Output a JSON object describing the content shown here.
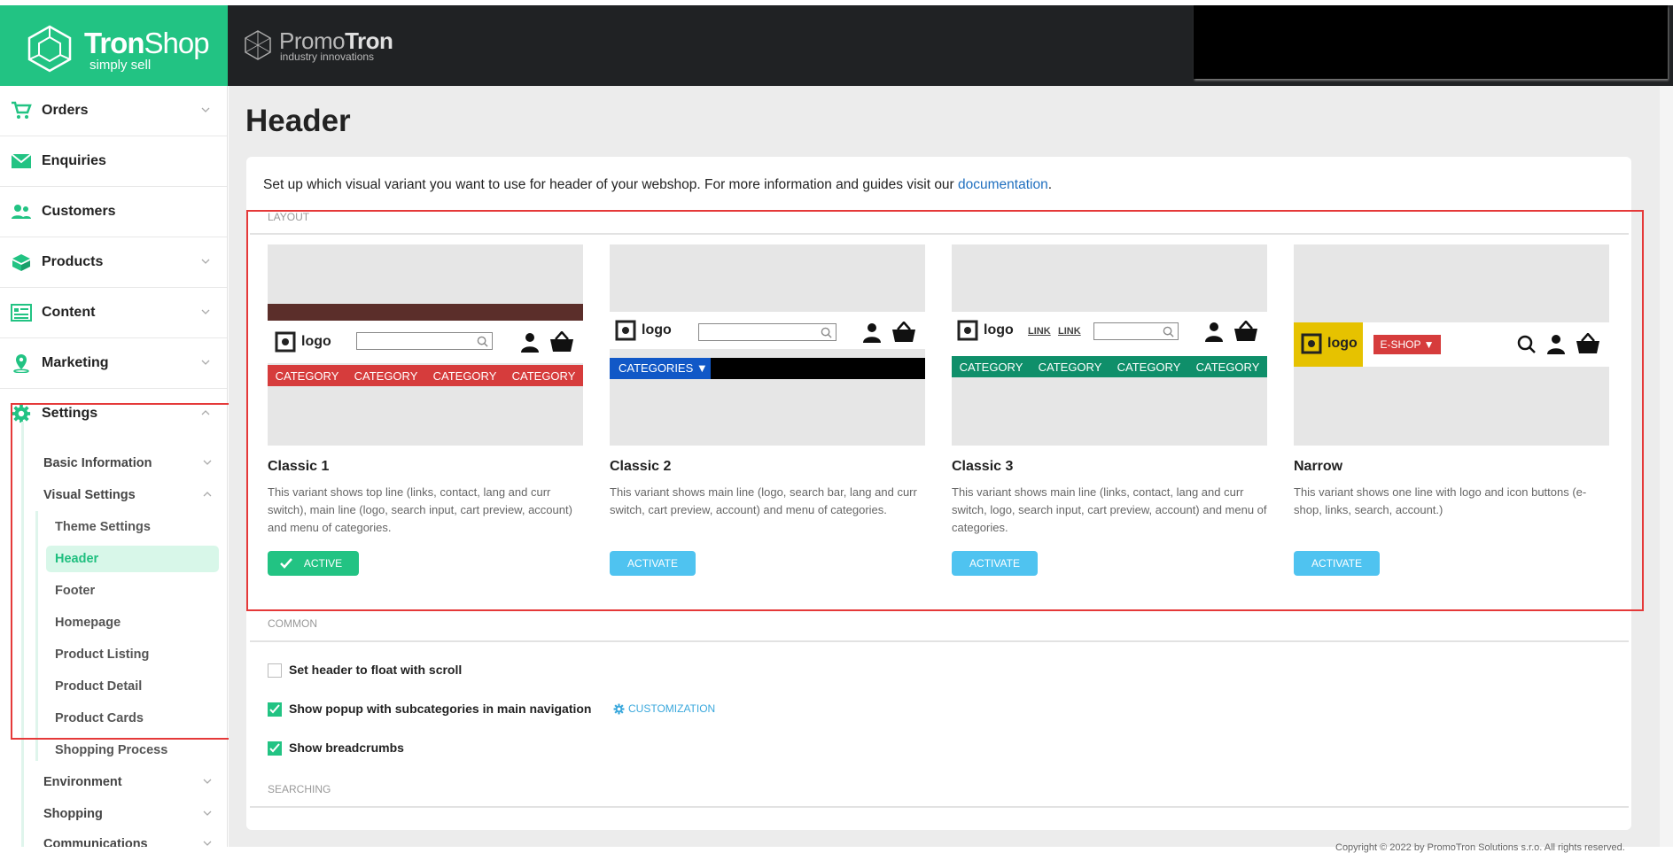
{
  "brand": {
    "name_bold": "Tron",
    "name_rest": "Shop",
    "tagline": "simply sell"
  },
  "partner": {
    "name_light": "Promo",
    "name_bold": "Tron",
    "tagline": "industry innovations"
  },
  "sidebar": {
    "items": [
      {
        "label": "Orders",
        "icon": "cart-icon"
      },
      {
        "label": "Enquiries",
        "icon": "envelope-icon"
      },
      {
        "label": "Customers",
        "icon": "users-icon"
      },
      {
        "label": "Products",
        "icon": "box-icon"
      },
      {
        "label": "Content",
        "icon": "content-icon"
      },
      {
        "label": "Marketing",
        "icon": "map-pin-icon"
      },
      {
        "label": "Settings",
        "icon": "gear-icon"
      }
    ],
    "settings_sub": [
      "Basic Information",
      "Visual Settings",
      "Environment",
      "Shopping",
      "Communications"
    ],
    "visual_sub": [
      "Theme Settings",
      "Header",
      "Footer",
      "Homepage",
      "Product Listing",
      "Product Detail",
      "Product Cards",
      "Shopping Process"
    ]
  },
  "page": {
    "title": "Header",
    "intro_text": "Set up which visual variant you want to use for header of your webshop. For more information and guides visit our ",
    "intro_link": "documentation",
    "intro_end": "."
  },
  "layout": {
    "section_label": "Layout",
    "variants": [
      {
        "title": "Classic 1",
        "desc": "This variant shows top line (links, contact, lang and curr switch), main line (logo, search input, cart preview, account) and menu of categories.",
        "button": "Active",
        "active": true
      },
      {
        "title": "Classic 2",
        "desc": "This variant shows main line (logo, search bar, lang and curr switch, cart preview, account) and menu of categories.",
        "button": "Activate",
        "active": false
      },
      {
        "title": "Classic 3",
        "desc": "This variant shows main line (links, contact, lang and curr switch, logo, search input, cart preview, account) and menu of categories.",
        "button": "Activate",
        "active": false
      },
      {
        "title": "Narrow",
        "desc": "This variant shows one line with logo and icon buttons (e-shop, links, search, account.)",
        "button": "Activate",
        "active": false
      }
    ],
    "preview_text": {
      "logo": "logo",
      "category": "CATEGORY",
      "categories_dd": "CATEGORIES ▼",
      "link": "LINK",
      "eshop_dd": "E-SHOP ▼"
    }
  },
  "common": {
    "section_label": "Common",
    "options": [
      {
        "label": "Set header to float with scroll",
        "checked": false
      },
      {
        "label": "Show popup with subcategories in main navigation",
        "checked": true
      },
      {
        "label": "Show breadcrumbs",
        "checked": true
      }
    ],
    "customization_label": "CUSTOMIZATION"
  },
  "searching": {
    "section_label": "Searching"
  },
  "footer": {
    "copyright": "Copyright © 2022 by PromoTron Solutions s.r.o. All rights reserved."
  },
  "colors": {
    "brand": "#22c383",
    "category_red": "#d63c3c",
    "classic2_blue": "#1158c7",
    "classic3_green": "#0f8f6a",
    "narrow_yellow": "#e6c200"
  }
}
